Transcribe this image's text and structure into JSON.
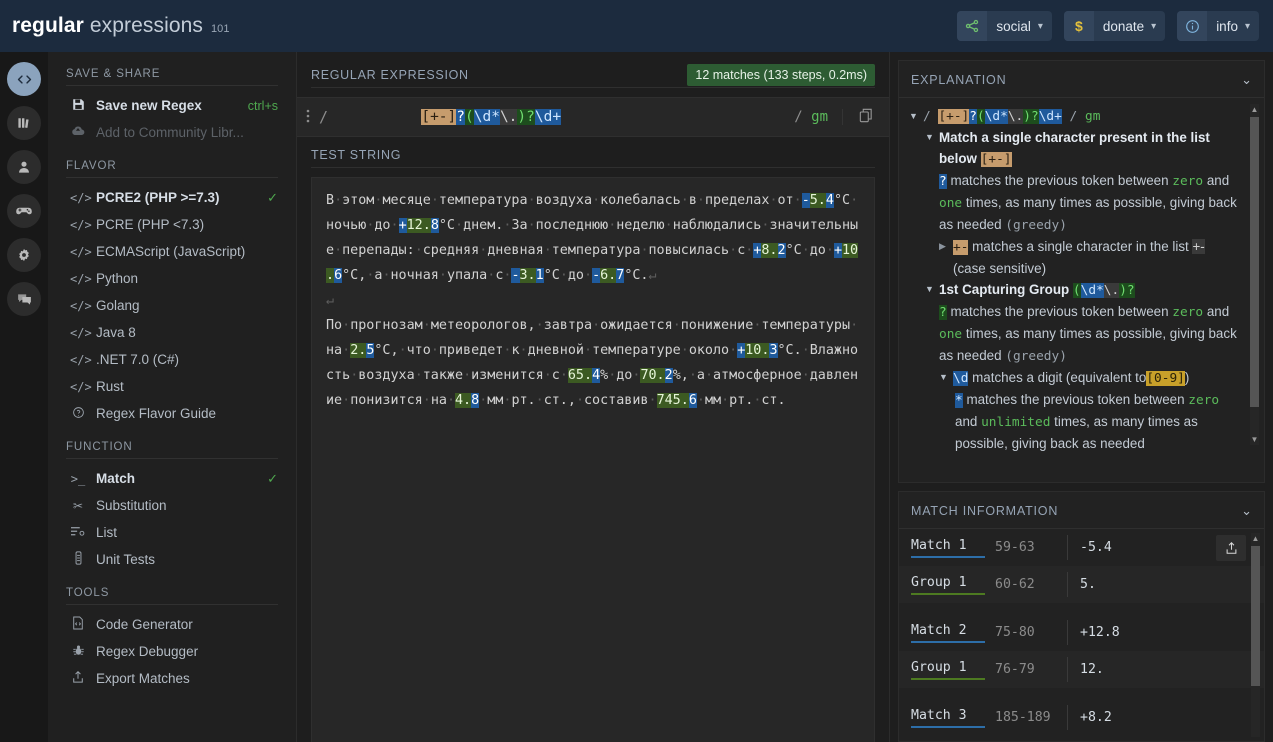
{
  "topbar": {
    "brand_bold": "regular",
    "brand_light": "expressions",
    "brand_sup": "101",
    "actions": [
      {
        "icon": "share-nodes-icon",
        "glyph": "⤳",
        "label": "social",
        "caret": "▾"
      },
      {
        "icon": "dollar-icon",
        "glyph": "$",
        "label": "donate",
        "caret": "▾"
      },
      {
        "icon": "info-circle-icon",
        "glyph": "ⓘ",
        "label": "info",
        "caret": "▾"
      }
    ]
  },
  "rail": [
    {
      "name": "code-icon",
      "glyph": "</>",
      "active": true
    },
    {
      "name": "library-icon",
      "glyph": "▥",
      "active": false
    },
    {
      "name": "account-icon",
      "glyph": "👤",
      "active": false
    },
    {
      "name": "gamepad-icon",
      "glyph": "🎮",
      "active": false
    },
    {
      "name": "settings-gear-icon",
      "glyph": "⚙",
      "active": false
    },
    {
      "name": "chat-feedback-icon",
      "glyph": "💬",
      "active": false
    }
  ],
  "menu": {
    "save_share_title": "SAVE & SHARE",
    "save_new_regex": "Save new Regex",
    "save_new_regex_shortcut": "ctrl+s",
    "add_to_community": "Add to Community Libr...",
    "flavor_title": "FLAVOR",
    "flavors": [
      {
        "label": "PCRE2 (PHP >=7.3)",
        "selected": true
      },
      {
        "label": "PCRE (PHP <7.3)",
        "selected": false
      },
      {
        "label": "ECMAScript (JavaScript)",
        "selected": false
      },
      {
        "label": "Python",
        "selected": false
      },
      {
        "label": "Golang",
        "selected": false
      },
      {
        "label": "Java 8",
        "selected": false
      },
      {
        "label": ".NET 7.0 (C#)",
        "selected": false
      },
      {
        "label": "Rust",
        "selected": false
      }
    ],
    "flavor_guide": "Regex Flavor Guide",
    "function_title": "FUNCTION",
    "functions": [
      {
        "label": "Match",
        "icon": "terminal-icon",
        "glyph": ">_",
        "selected": true
      },
      {
        "label": "Substitution",
        "icon": "scissors-icon",
        "glyph": "✂",
        "selected": false
      },
      {
        "label": "List",
        "icon": "list-icon",
        "glyph": "☰",
        "selected": false
      },
      {
        "label": "Unit Tests",
        "icon": "test-tube-icon",
        "glyph": "⌸",
        "selected": false
      }
    ],
    "tools_title": "TOOLS",
    "tools": [
      {
        "label": "Code Generator",
        "icon": "code-file-icon",
        "glyph": "🗎"
      },
      {
        "label": "Regex Debugger",
        "icon": "bug-icon",
        "glyph": "🐞"
      },
      {
        "label": "Export Matches",
        "icon": "export-icon",
        "glyph": "⇧"
      }
    ]
  },
  "regex_panel": {
    "title": "REGULAR EXPRESSION",
    "matches_badge": "12 matches (133 steps, 0.2ms)",
    "delimiter": "/",
    "flags_slash": "/",
    "flags": "gm",
    "pattern_plain": "[+-]?(\\d*\\.)?\\d+",
    "pattern_tokens": [
      {
        "text": "[+-]",
        "cls": "t-class"
      },
      {
        "text": "?",
        "cls": "t-quant-blue"
      },
      {
        "text": "(",
        "cls": "t-group"
      },
      {
        "text": "\\d",
        "cls": "t-meta"
      },
      {
        "text": "*",
        "cls": "t-meta"
      },
      {
        "text": "\\.",
        "cls": "t-esc"
      },
      {
        "text": ")",
        "cls": "t-group"
      },
      {
        "text": "?",
        "cls": "t-quant-green"
      },
      {
        "text": "\\d+",
        "cls": "t-meta"
      }
    ]
  },
  "test_string": {
    "title": "TEST STRING",
    "paragraph_1": [
      {
        "t": "В",
        "k": "p"
      },
      {
        "t": "·",
        "k": "d"
      },
      {
        "t": "этом",
        "k": "p"
      },
      {
        "t": "·",
        "k": "d"
      },
      {
        "t": "месяце",
        "k": "p"
      },
      {
        "t": "·",
        "k": "d"
      },
      {
        "t": "температура",
        "k": "p"
      },
      {
        "t": "·",
        "k": "d"
      },
      {
        "t": "воздуха",
        "k": "p"
      },
      {
        "t": "·",
        "k": "d"
      },
      {
        "t": "колебалась",
        "k": "p"
      },
      {
        "t": "·",
        "k": "d"
      },
      {
        "t": "в",
        "k": "p"
      },
      {
        "t": "·",
        "k": "d"
      },
      {
        "t": "пределах",
        "k": "p"
      },
      {
        "t": "·",
        "k": "d"
      },
      {
        "t": "от",
        "k": "p"
      },
      {
        "t": "·",
        "k": "d"
      },
      {
        "t": "-",
        "k": "s"
      },
      {
        "t": "5.",
        "k": "g"
      },
      {
        "t": "4",
        "k": "e"
      },
      {
        "t": "°C",
        "k": "p"
      },
      {
        "t": "·",
        "k": "d"
      },
      {
        "t": "ночью",
        "k": "p"
      },
      {
        "t": "·",
        "k": "d"
      },
      {
        "t": "до",
        "k": "p"
      },
      {
        "t": "·",
        "k": "d"
      },
      {
        "t": "+",
        "k": "s"
      },
      {
        "t": "12.",
        "k": "g"
      },
      {
        "t": "8",
        "k": "e"
      },
      {
        "t": "°C",
        "k": "p"
      },
      {
        "t": "·",
        "k": "d"
      },
      {
        "t": "днем.",
        "k": "p"
      },
      {
        "t": "·",
        "k": "d"
      },
      {
        "t": "За",
        "k": "p"
      },
      {
        "t": "·",
        "k": "d"
      },
      {
        "t": "последнюю",
        "k": "p"
      },
      {
        "t": "·",
        "k": "d"
      },
      {
        "t": "неделю",
        "k": "p"
      },
      {
        "t": "·",
        "k": "d"
      },
      {
        "t": "наблюдались",
        "k": "p"
      },
      {
        "t": "·",
        "k": "d"
      },
      {
        "t": "значительные",
        "k": "p"
      },
      {
        "t": "·",
        "k": "d"
      },
      {
        "t": "перепады:",
        "k": "p"
      },
      {
        "t": "·",
        "k": "d"
      },
      {
        "t": "средняя",
        "k": "p"
      },
      {
        "t": "·",
        "k": "d"
      },
      {
        "t": "дневная",
        "k": "p"
      },
      {
        "t": "·",
        "k": "d"
      },
      {
        "t": "температура",
        "k": "p"
      },
      {
        "t": "·",
        "k": "d"
      },
      {
        "t": "повысилась",
        "k": "p"
      },
      {
        "t": "·",
        "k": "d"
      },
      {
        "t": "с",
        "k": "p"
      },
      {
        "t": "·",
        "k": "d"
      },
      {
        "t": "+",
        "k": "s"
      },
      {
        "t": "8.",
        "k": "g"
      },
      {
        "t": "2",
        "k": "e"
      },
      {
        "t": "°C",
        "k": "p"
      },
      {
        "t": "·",
        "k": "d"
      },
      {
        "t": "до",
        "k": "p"
      },
      {
        "t": "·",
        "k": "d"
      },
      {
        "t": "+",
        "k": "s"
      },
      {
        "t": "10.",
        "k": "g"
      },
      {
        "t": "6",
        "k": "e"
      },
      {
        "t": "°C,",
        "k": "p"
      },
      {
        "t": "·",
        "k": "d"
      },
      {
        "t": "а",
        "k": "p"
      },
      {
        "t": "·",
        "k": "d"
      },
      {
        "t": "ночная",
        "k": "p"
      },
      {
        "t": "·",
        "k": "d"
      },
      {
        "t": "упала",
        "k": "p"
      },
      {
        "t": "·",
        "k": "d"
      },
      {
        "t": "с",
        "k": "p"
      },
      {
        "t": "·",
        "k": "d"
      },
      {
        "t": "-",
        "k": "s"
      },
      {
        "t": "3.",
        "k": "g"
      },
      {
        "t": "1",
        "k": "e"
      },
      {
        "t": "°C",
        "k": "p"
      },
      {
        "t": "·",
        "k": "d"
      },
      {
        "t": "до",
        "k": "p"
      },
      {
        "t": "·",
        "k": "d"
      },
      {
        "t": "-",
        "k": "s"
      },
      {
        "t": "6.",
        "k": "g"
      },
      {
        "t": "7",
        "k": "e"
      },
      {
        "t": "°C.",
        "k": "p"
      },
      {
        "t": "↵",
        "k": "n"
      }
    ],
    "blank_line": "↵",
    "paragraph_2": [
      {
        "t": "По",
        "k": "p"
      },
      {
        "t": "·",
        "k": "d"
      },
      {
        "t": "прогнозам",
        "k": "p"
      },
      {
        "t": "·",
        "k": "d"
      },
      {
        "t": "метеорологов,",
        "k": "p"
      },
      {
        "t": "·",
        "k": "d"
      },
      {
        "t": "завтра",
        "k": "p"
      },
      {
        "t": "·",
        "k": "d"
      },
      {
        "t": "ожидается",
        "k": "p"
      },
      {
        "t": "·",
        "k": "d"
      },
      {
        "t": "понижение",
        "k": "p"
      },
      {
        "t": "·",
        "k": "d"
      },
      {
        "t": "температуры",
        "k": "p"
      },
      {
        "t": "·",
        "k": "d"
      },
      {
        "t": "на",
        "k": "p"
      },
      {
        "t": "·",
        "k": "d"
      },
      {
        "t": "2.",
        "k": "g"
      },
      {
        "t": "5",
        "k": "e"
      },
      {
        "t": "°C,",
        "k": "p"
      },
      {
        "t": "·",
        "k": "d"
      },
      {
        "t": "что",
        "k": "p"
      },
      {
        "t": "·",
        "k": "d"
      },
      {
        "t": "приведет",
        "k": "p"
      },
      {
        "t": "·",
        "k": "d"
      },
      {
        "t": "к",
        "k": "p"
      },
      {
        "t": "·",
        "k": "d"
      },
      {
        "t": "дневной",
        "k": "p"
      },
      {
        "t": "·",
        "k": "d"
      },
      {
        "t": "температуре",
        "k": "p"
      },
      {
        "t": "·",
        "k": "d"
      },
      {
        "t": "около",
        "k": "p"
      },
      {
        "t": "·",
        "k": "d"
      },
      {
        "t": "+",
        "k": "s"
      },
      {
        "t": "10.",
        "k": "g"
      },
      {
        "t": "3",
        "k": "e"
      },
      {
        "t": "°C.",
        "k": "p"
      },
      {
        "t": "·",
        "k": "d"
      },
      {
        "t": "Влажность",
        "k": "p"
      },
      {
        "t": "·",
        "k": "d"
      },
      {
        "t": "воздуха",
        "k": "p"
      },
      {
        "t": "·",
        "k": "d"
      },
      {
        "t": "также",
        "k": "p"
      },
      {
        "t": "·",
        "k": "d"
      },
      {
        "t": "изменится",
        "k": "p"
      },
      {
        "t": "·",
        "k": "d"
      },
      {
        "t": "с",
        "k": "p"
      },
      {
        "t": "·",
        "k": "d"
      },
      {
        "t": "65.",
        "k": "g"
      },
      {
        "t": "4",
        "k": "e"
      },
      {
        "t": "%",
        "k": "p"
      },
      {
        "t": "·",
        "k": "d"
      },
      {
        "t": "до",
        "k": "p"
      },
      {
        "t": "·",
        "k": "d"
      },
      {
        "t": "70.",
        "k": "g"
      },
      {
        "t": "2",
        "k": "e"
      },
      {
        "t": "%,",
        "k": "p"
      },
      {
        "t": "·",
        "k": "d"
      },
      {
        "t": "а",
        "k": "p"
      },
      {
        "t": "·",
        "k": "d"
      },
      {
        "t": "атмосферное",
        "k": "p"
      },
      {
        "t": "·",
        "k": "d"
      },
      {
        "t": "давление",
        "k": "p"
      },
      {
        "t": "·",
        "k": "d"
      },
      {
        "t": "понизится",
        "k": "p"
      },
      {
        "t": "·",
        "k": "d"
      },
      {
        "t": "на",
        "k": "p"
      },
      {
        "t": "·",
        "k": "d"
      },
      {
        "t": "4.",
        "k": "g"
      },
      {
        "t": "8",
        "k": "e"
      },
      {
        "t": "·",
        "k": "d"
      },
      {
        "t": "мм",
        "k": "p"
      },
      {
        "t": "·",
        "k": "d"
      },
      {
        "t": "рт.",
        "k": "p"
      },
      {
        "t": "·",
        "k": "d"
      },
      {
        "t": "ст.,",
        "k": "p"
      },
      {
        "t": "·",
        "k": "d"
      },
      {
        "t": "составив",
        "k": "p"
      },
      {
        "t": "·",
        "k": "d"
      },
      {
        "t": "745.",
        "k": "g"
      },
      {
        "t": "6",
        "k": "e"
      },
      {
        "t": "·",
        "k": "d"
      },
      {
        "t": "мм",
        "k": "p"
      },
      {
        "t": "·",
        "k": "d"
      },
      {
        "t": "рт.",
        "k": "p"
      },
      {
        "t": "·",
        "k": "d"
      },
      {
        "t": "ст.",
        "k": "p"
      }
    ]
  },
  "explanation": {
    "title": "EXPLANATION",
    "caret": "⌄",
    "header_pattern_prefix": "/",
    "header_flags_slash": "/",
    "header_flags": "gm",
    "nodes": [
      {
        "text": "Match a single character present in the list below",
        "token": "[+-]"
      },
      {
        "text": "matches the previous token between zero and one times, as many times as possible, giving back as needed (greedy)",
        "token": "?"
      },
      {
        "text": "matches a single character in the list +- (case sensitive)",
        "token": "+-"
      },
      {
        "text": "1st Capturing Group",
        "token": "(\\d*\\.)?"
      },
      {
        "text": "\\d matches a digit (equivalent to [0-9])",
        "token": "\\d"
      },
      {
        "text": "* matches the previous token between zero and unlimited times, as many times as possible, giving back as needed",
        "token": "*"
      }
    ],
    "words": {
      "zero": "zero",
      "one": "one",
      "unlimited": "unlimited",
      "greedy": "(greedy)",
      "match_list_head": "Match a single character present in the list",
      "match_list_below": "below",
      "matches_prev": "matches the previous token between",
      "and": "and",
      "times_possible": "times, as many times as possible,",
      "giving_back": "giving back as needed",
      "matches_single": "matches a single character in the list",
      "plus_minus": "+-",
      "case_sensitive": "(case sensitive)",
      "group_title": "1st Capturing Group",
      "digit_matches": "matches a digit (equivalent to",
      "digit_class": "[0-9]",
      "close_paren": ")",
      "star_matches": "matches the previous token between",
      "times_many": "times, as many times",
      "as_possible_giving": "as possible, giving back as needed"
    }
  },
  "match_information": {
    "title": "MATCH INFORMATION",
    "caret": "⌄",
    "share_icon": "export-icon",
    "rows": [
      {
        "kind": "match",
        "label": "Match 1",
        "range": "59-63",
        "value": "-5.4"
      },
      {
        "kind": "group",
        "label": "Group 1",
        "range": "60-62",
        "value": "5."
      },
      {
        "kind": "gap"
      },
      {
        "kind": "match",
        "label": "Match 2",
        "range": "75-80",
        "value": "+12.8"
      },
      {
        "kind": "group",
        "label": "Group 1",
        "range": "76-79",
        "value": "12."
      },
      {
        "kind": "gap"
      },
      {
        "kind": "match",
        "label": "Match 3",
        "range": "185-189",
        "value": "+8.2"
      }
    ]
  },
  "colors": {
    "accent_green": "#4fa84f",
    "match_blue": "#1f5a9c",
    "group_green": "#3c5a22",
    "char_class_tan": "#c69c6d",
    "badge_green": "#2d5c33",
    "topbar_navy": "#1c2b3e"
  }
}
